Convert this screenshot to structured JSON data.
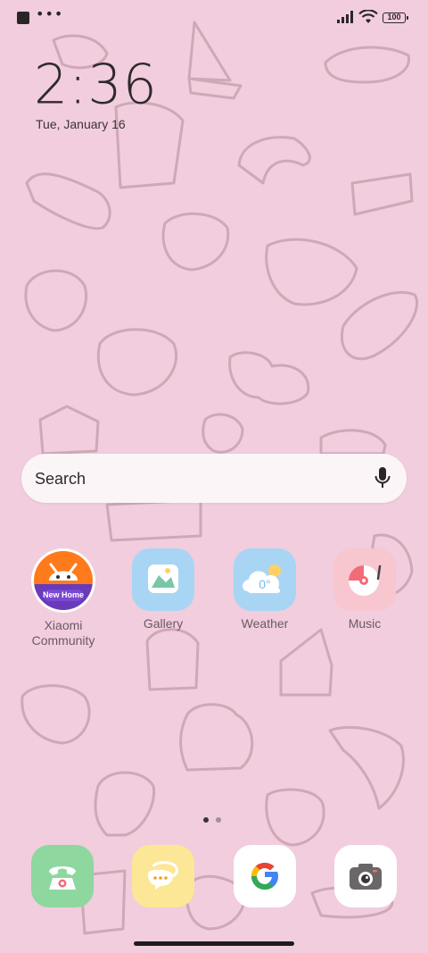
{
  "status_bar": {
    "battery": "100"
  },
  "clock": {
    "time": "2:36",
    "date": "Tue, January 16"
  },
  "search": {
    "placeholder": "Search"
  },
  "apps": [
    {
      "label": "Xiaomi\nCommunity",
      "badge": "New Home"
    },
    {
      "label": "Gallery"
    },
    {
      "label": "Weather",
      "temp": "0°"
    },
    {
      "label": "Music"
    }
  ],
  "dock": [
    "phone-icon",
    "messages-icon",
    "google-icon",
    "camera-icon"
  ],
  "colors": {
    "wallpaper": "#f1cdde",
    "gallery": "#a8d5f4",
    "weather": "#a8d5f4",
    "music": "#f8c6ce",
    "phone": "#8ed79f",
    "messages": "#fbe795"
  }
}
